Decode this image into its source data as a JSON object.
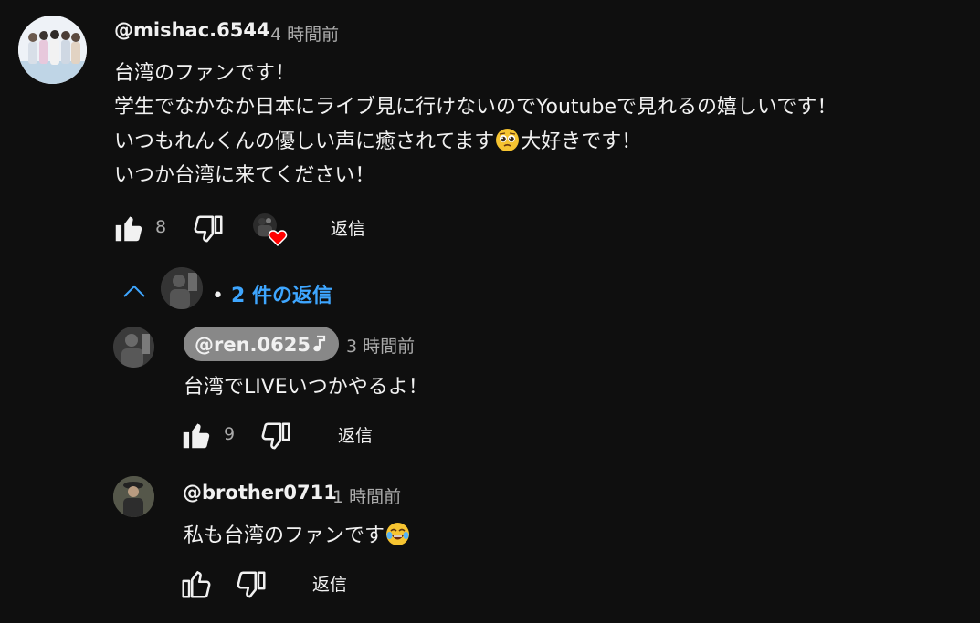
{
  "top_comment": {
    "handle": "@mishac.6544",
    "time": "4 時間前",
    "lines": [
      "台湾のファンです！",
      "学生でなかなか日本にライブ見に行けないのでYoutubeで見れるの嬉しいです！",
      "いつもれんくんの優しい声に癒されてます",
      "大好きです！",
      "いつか台湾に来てください！"
    ],
    "emoji": "pleading-face",
    "likes": "8",
    "reply_label": "返信",
    "liked": true,
    "creator_heart": true
  },
  "replies_toggle": {
    "count_label": "2 件の返信",
    "bullet": "•",
    "expanded": true
  },
  "replies": [
    {
      "handle": "@ren.0625",
      "is_creator": true,
      "creator_badge": "music-note-icon",
      "time": "3 時間前",
      "text": "台湾でLIVEいつかやるよ！",
      "likes": "9",
      "liked": true,
      "reply_label": "返信"
    },
    {
      "handle": "@brother0711",
      "is_creator": false,
      "time": "1 時間前",
      "text": "私も台湾のファンです",
      "emoji": "tears-of-joy-face",
      "likes": "",
      "liked": false,
      "reply_label": "返信"
    }
  ],
  "colors": {
    "background": "#0f0f0f",
    "text": "#f1f1f1",
    "muted": "#aaaaaa",
    "link": "#3ea6ff",
    "creator_pill": "#888888",
    "heart": "#ff0000"
  }
}
